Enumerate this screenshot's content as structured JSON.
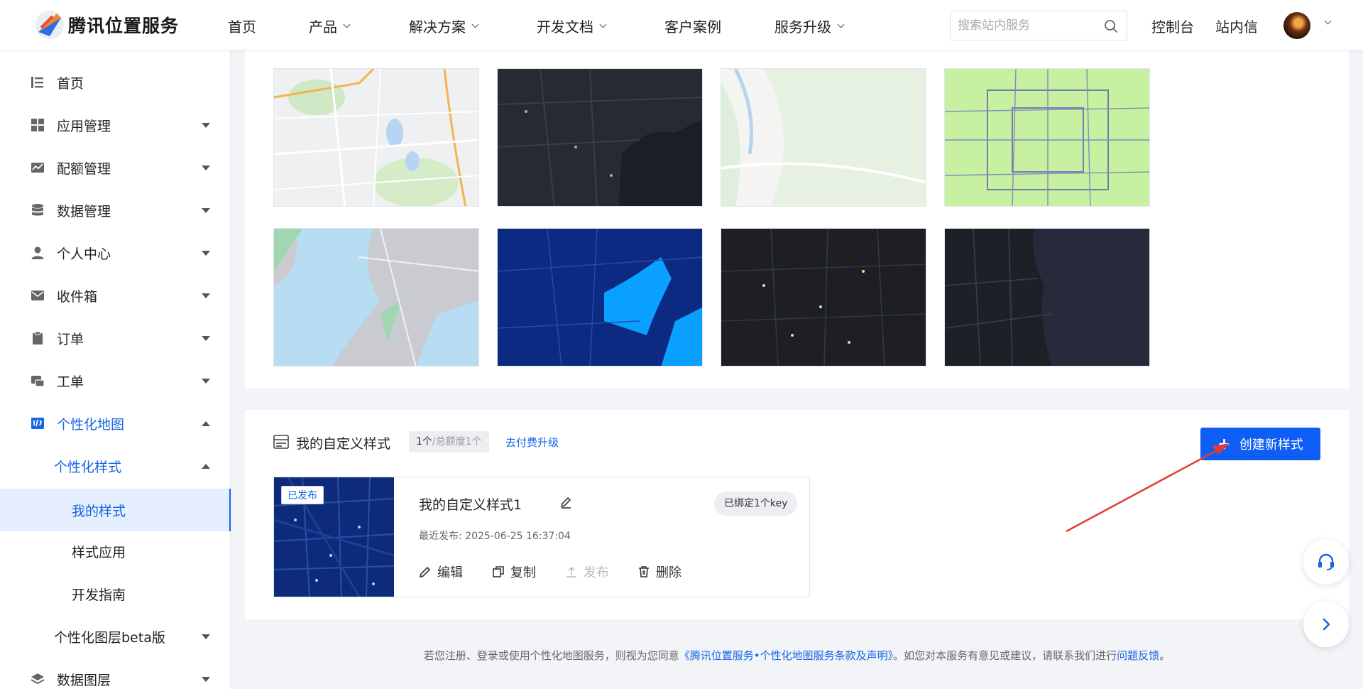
{
  "header": {
    "logo_text": "腾讯位置服务",
    "nav": [
      {
        "label": "首页",
        "has_dropdown": false
      },
      {
        "label": "产品",
        "has_dropdown": true
      },
      {
        "label": "解决方案",
        "has_dropdown": true
      },
      {
        "label": "开发文档",
        "has_dropdown": true
      },
      {
        "label": "客户案例",
        "has_dropdown": false
      },
      {
        "label": "服务升级",
        "has_dropdown": true
      }
    ],
    "search_placeholder": "搜索站内服务",
    "console": "控制台",
    "inbox": "站内信"
  },
  "sidebar": {
    "items": [
      {
        "label": "首页",
        "icon": "list-icon"
      },
      {
        "label": "应用管理",
        "icon": "grid-icon"
      },
      {
        "label": "配额管理",
        "icon": "chart-icon"
      },
      {
        "label": "数据管理",
        "icon": "database-icon"
      },
      {
        "label": "个人中心",
        "icon": "user-icon"
      },
      {
        "label": " 收件箱",
        "icon": "mail-icon"
      },
      {
        "label": "订单",
        "icon": "clipboard-icon"
      },
      {
        "label": "工单",
        "icon": "ticket-icon"
      },
      {
        "label": "个性化地图",
        "icon": "map-style-icon"
      },
      {
        "label": "个性化样式"
      },
      {
        "label": "我的样式"
      },
      {
        "label": "样式应用"
      },
      {
        "label": "开发指南"
      },
      {
        "label": "个性化图层beta版"
      },
      {
        "label": "数据图层",
        "icon": "layers-icon"
      }
    ]
  },
  "my_styles": {
    "title": "我的自定义样式",
    "quota_used": "1个",
    "quota_total": "/总额度1个",
    "upgrade_link": "去付费升级",
    "create_button": "创建新样式",
    "card": {
      "status": "已发布",
      "name": "我的自定义样式1",
      "key_badge": "已绑定1个key",
      "published": "最近发布: 2025-06-25 16:37:04",
      "actions": {
        "edit": "编辑",
        "copy": "复制",
        "publish": "发布",
        "delete": "删除"
      }
    }
  },
  "footer": {
    "prefix": "若您注册、登录或使用个性化地图服务，则视为您同意",
    "terms_link": "《腾讯位置服务•个性化地图服务条款及声明》",
    "middle": "。如您对本服务有意见或建议，请联系我们进行",
    "feedback_link": "问题反馈",
    "suffix": "。"
  },
  "colors": {
    "primary": "#0e5ef5",
    "link": "#1565e6",
    "annotation_arrow": "#e53935"
  }
}
